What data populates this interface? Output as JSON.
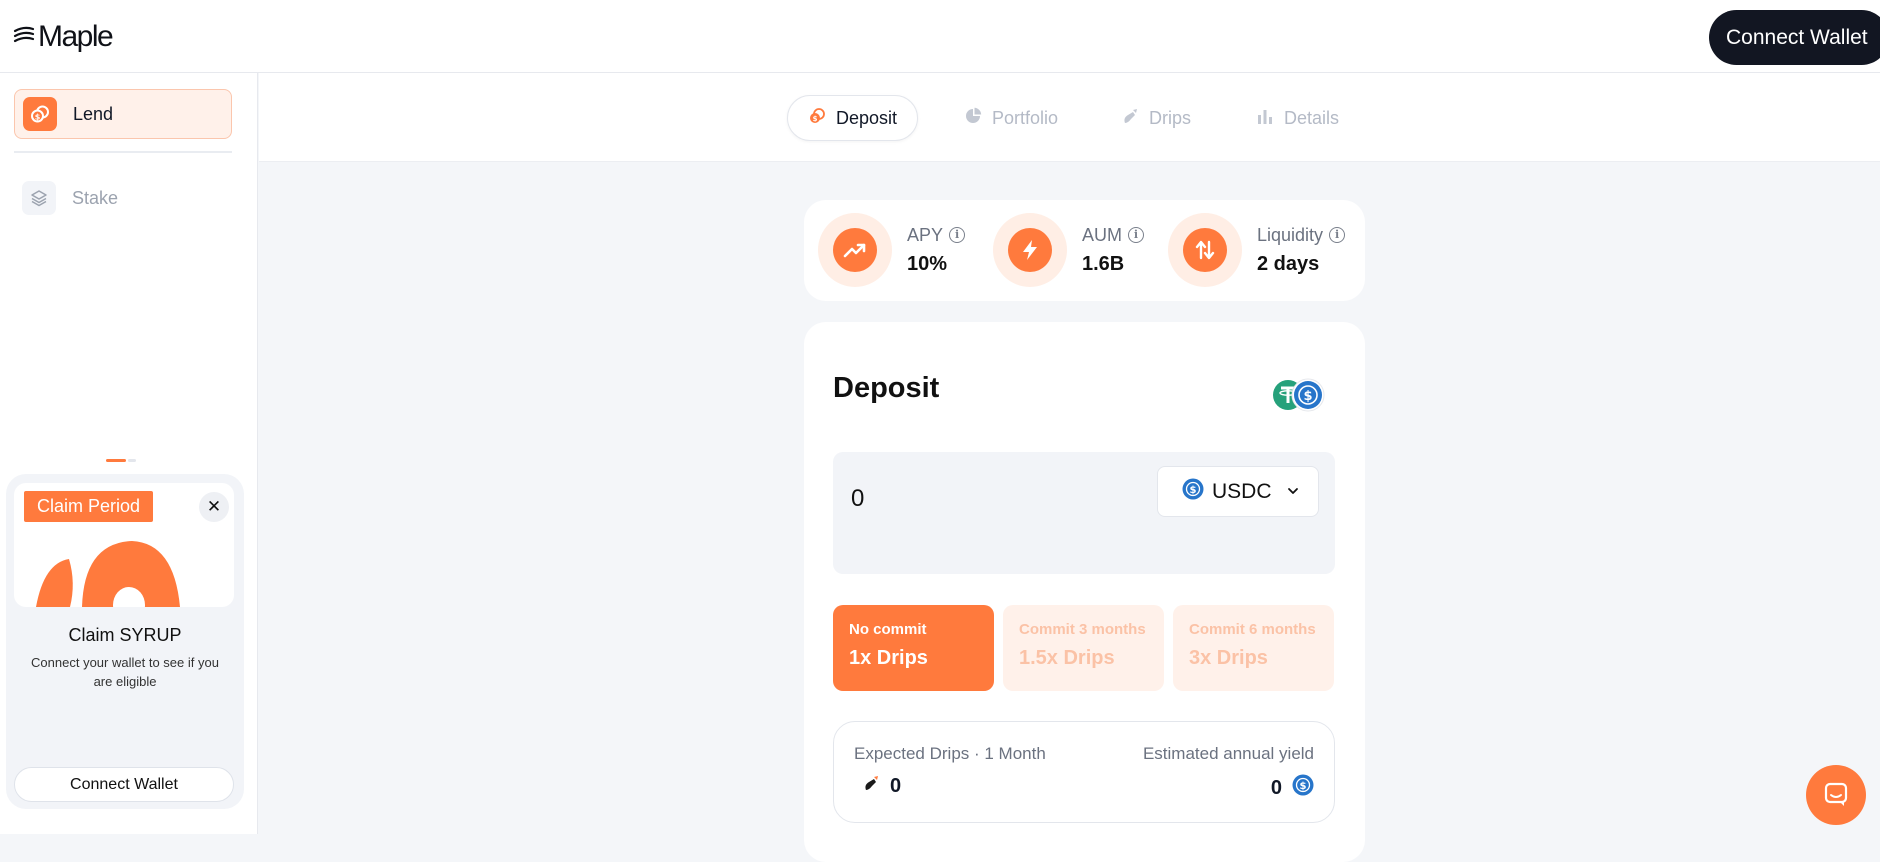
{
  "header": {
    "brand": "Maple",
    "logo_icon": "maple-logo-icon",
    "connect_wallet_label": "Connect Wallet"
  },
  "sidebar": {
    "items": [
      {
        "label": "Lend",
        "icon": "lend-icon",
        "active": true
      },
      {
        "label": "Stake",
        "icon": "layers-icon",
        "active": false
      }
    ],
    "claim": {
      "badge": "Claim Period",
      "title": "Claim SYRUP",
      "subtitle": "Connect your wallet to see if you are eligible",
      "button_label": "Connect Wallet",
      "close_icon": "close-icon"
    }
  },
  "tabs": [
    {
      "label": "Deposit",
      "icon": "coins-icon",
      "active": true
    },
    {
      "label": "Portfolio",
      "icon": "pie-chart-icon",
      "active": false
    },
    {
      "label": "Drips",
      "icon": "drip-icon",
      "active": false
    },
    {
      "label": "Details",
      "icon": "bar-chart-icon",
      "active": false
    }
  ],
  "stats": [
    {
      "label": "APY",
      "value": "10%",
      "icon": "trending-up-icon"
    },
    {
      "label": "AUM",
      "value": "1.6B",
      "icon": "lightning-icon"
    },
    {
      "label": "Liquidity",
      "value": "2 days",
      "icon": "swap-arrows-icon"
    }
  ],
  "deposit": {
    "title": "Deposit",
    "amount_value": "0",
    "token": "USDC",
    "token_icons": [
      "usdt-icon",
      "usdc-icon"
    ],
    "commit_options": [
      {
        "top": "No commit",
        "bottom": "1x Drips",
        "selected": true
      },
      {
        "top": "Commit 3 months",
        "bottom": "1.5x Drips",
        "selected": false
      },
      {
        "top": "Commit 6 months",
        "bottom": "3x Drips",
        "selected": false
      }
    ],
    "expected": {
      "drips_label": "Expected Drips · 1 Month",
      "drips_value": "0",
      "yield_label": "Estimated annual yield",
      "yield_value": "0"
    }
  },
  "colors": {
    "accent": "#ff7a3d",
    "accent_soft": "#fff1ea",
    "dark_button": "#121622",
    "usdc_blue": "#2775ca",
    "usdt_green": "#26a17b"
  },
  "chat": {
    "icon": "chat-icon"
  }
}
